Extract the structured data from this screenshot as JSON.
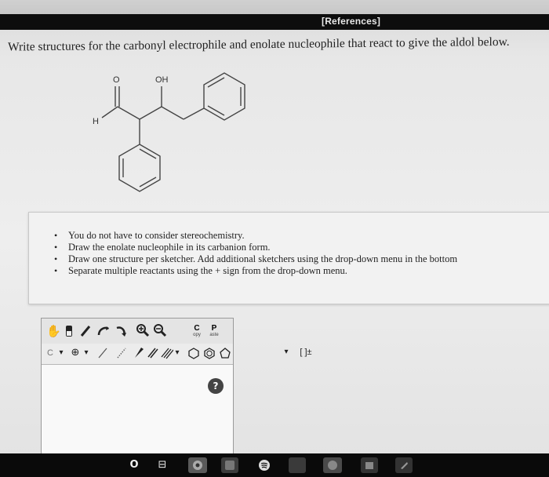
{
  "header": {
    "references_label": "[References]"
  },
  "question": {
    "text": "Write structures for the carbonyl electrophile and enolate nucleophile that react to give the aldol below."
  },
  "molecule": {
    "labels": {
      "carbonyl_oxygen": "O",
      "hydroxyl": "OH",
      "aldehyde_hydrogen": "H"
    }
  },
  "instructions": {
    "items": [
      "You do not have to consider stereochemistry.",
      "Draw the enolate nucleophile in its carbanion form.",
      "Draw one structure per sketcher. Add additional sketchers using the drop-down menu in the bottom",
      "Separate multiple reactants using the + sign from the drop-down menu."
    ]
  },
  "sketcher": {
    "toolbar": {
      "copy": {
        "big": "C",
        "small": "opy"
      },
      "paste": {
        "big": "P",
        "small": "aste"
      },
      "carbon_label": "C",
      "dropdown_symbol": "▾",
      "bracket_label": "[ ]±"
    },
    "help_label": "?"
  },
  "taskbar": {
    "search_symbol": "O",
    "task_view_symbol": "⊟"
  },
  "colors": {
    "reference_bar": "#0d0d0d",
    "panel_bg": "#f2f2f2",
    "taskbar": "#0a0a0a"
  }
}
